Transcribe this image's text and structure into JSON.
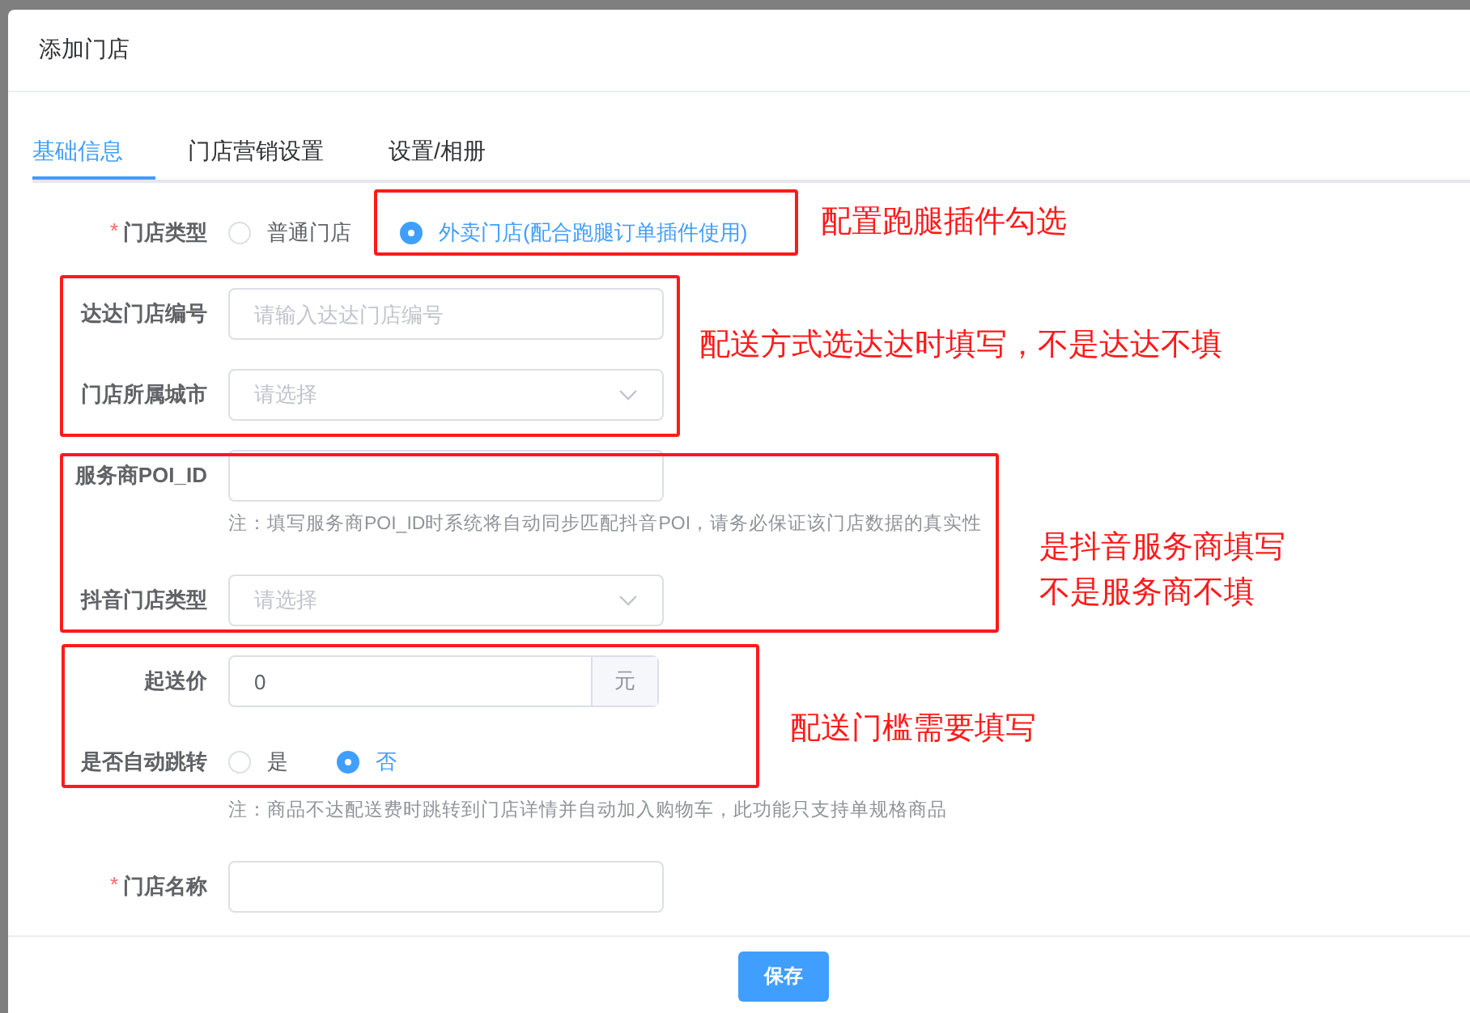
{
  "dialog": {
    "title": "添加门店"
  },
  "tabs": [
    {
      "label": "基础信息",
      "selected": true
    },
    {
      "label": "门店营销设置",
      "selected": false
    },
    {
      "label": "设置/相册",
      "selected": false
    }
  ],
  "fields": [
    {
      "kind": "radio",
      "mark": "*",
      "label": "门店类型",
      "options": [
        {
          "label": "普通门店",
          "selected": false
        },
        {
          "label": "外卖门店(配合跑腿订单插件使用)",
          "selected": true
        }
      ]
    },
    {
      "kind": "input",
      "label": "达达门店编号",
      "placeholder": "请输入达达门店编号"
    },
    {
      "kind": "select",
      "label": "门店所属城市",
      "placeholder": "请选择"
    },
    {
      "kind": "input",
      "label": "服务商POI_ID",
      "note": "注：填写服务商POI_ID时系统将自动同步匹配抖音POI，请务必保证该门店数据的真实性"
    },
    {
      "kind": "select",
      "label": "抖音门店类型",
      "placeholder": "请选择"
    },
    {
      "kind": "amount",
      "label": "起送价",
      "value": "0",
      "suffix": "元"
    },
    {
      "kind": "radio",
      "label": "是否自动跳转",
      "options": [
        {
          "label": "是",
          "selected": false
        },
        {
          "label": "否",
          "selected": true
        }
      ],
      "note": "注：商品不达配送费时跳转到门店详情并自动加入购物车，此功能只支持单规格商品"
    },
    {
      "kind": "input",
      "mark": "*",
      "label": "门店名称"
    }
  ],
  "save_button": "保存",
  "annotations": [
    {
      "lines": [
        "配置跑腿插件勾选"
      ]
    },
    {
      "lines": [
        "配送方式选达达时填写，不是达达不填"
      ]
    },
    {
      "lines": [
        "是抖音服务商填写",
        "不是服务商不填"
      ]
    },
    {
      "lines": [
        "配送门槛需要填写"
      ]
    }
  ]
}
